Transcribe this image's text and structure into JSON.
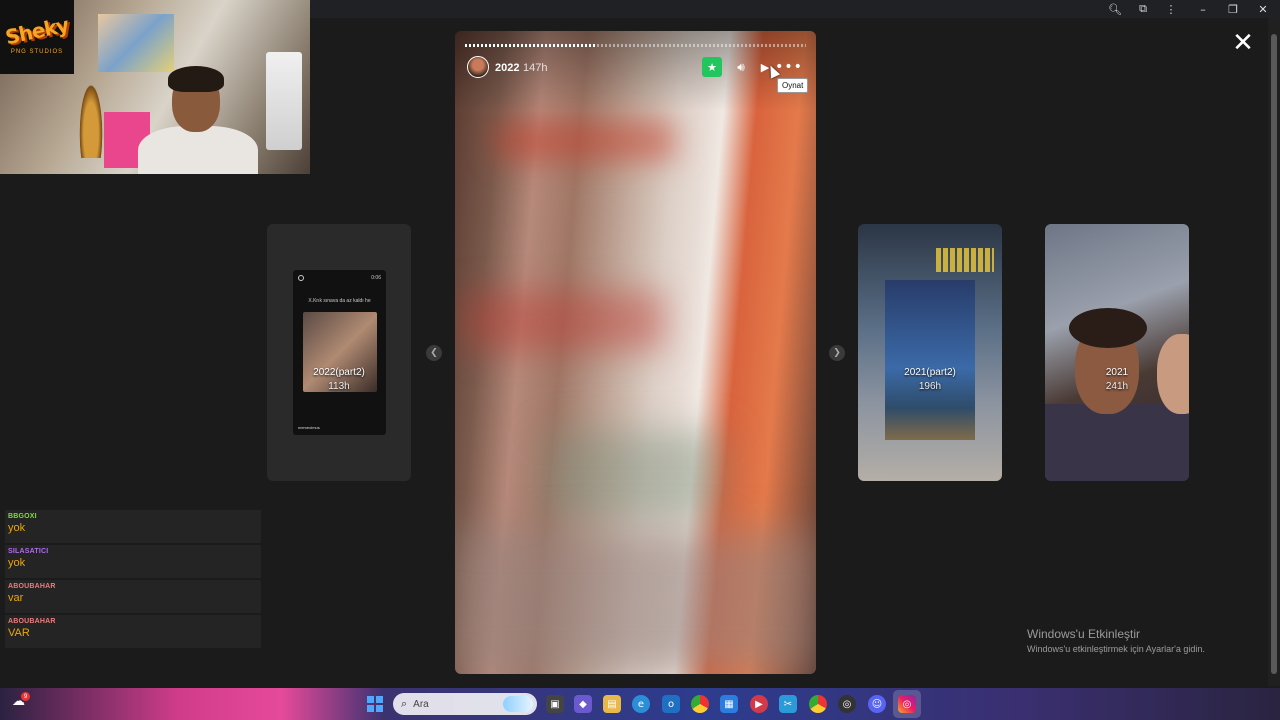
{
  "logo": {
    "text": "Sheky",
    "subtitle": "PNG STUDIOS"
  },
  "story": {
    "username": "2022",
    "time": "147h",
    "progress": 0.38,
    "tooltip": "Oynat"
  },
  "cards": [
    {
      "title": "2022(part2)",
      "time": "113h",
      "caption": "X.Krık sınava da az kaldı he",
      "clock": "0:06",
      "tag": "memeolmus"
    },
    {
      "title": "2021(part2)",
      "time": "196h"
    },
    {
      "title": "2021",
      "time": "241h"
    }
  ],
  "chat": [
    {
      "user": "BBGOXI",
      "text": "yok",
      "color": "#7ee02b"
    },
    {
      "user": "SILASATICI",
      "text": "yok",
      "color": "#b06bf0"
    },
    {
      "user": "ABOUBAHAR",
      "text": "var",
      "color": "#f07b7b"
    },
    {
      "user": "ABOUBAHAR",
      "text": "VAR",
      "color": "#f07b7b"
    }
  ],
  "watermark": {
    "title": "Windows'u Etkinleştir",
    "subtitle": "Windows'u etkinleştirmek için Ayarlar'a gidin."
  },
  "taskbar": {
    "search_placeholder": "Ara",
    "weather_badge": "9",
    "icons": [
      "task-view-icon",
      "widgets-icon",
      "file-explorer-icon",
      "edge-icon",
      "outlook-icon",
      "chrome-icon",
      "store-icon",
      "media-player-icon",
      "vscode-icon",
      "chrome-alt-icon",
      "obs-icon",
      "discord-icon",
      "instagram-icon"
    ]
  }
}
